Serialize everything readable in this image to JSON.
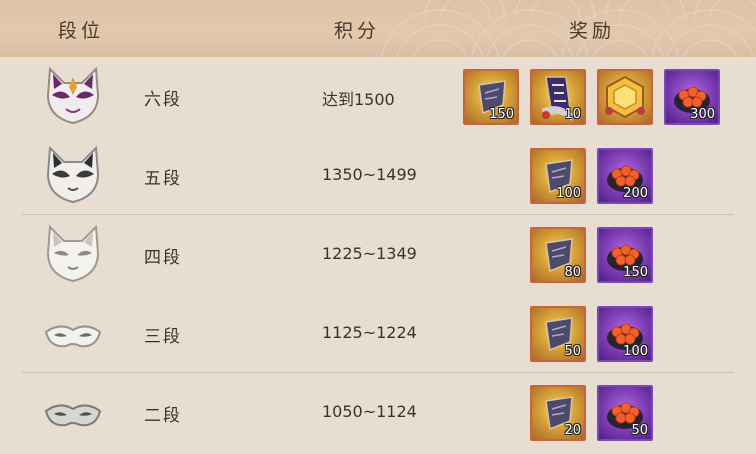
{
  "header": {
    "col_rank": "段位",
    "col_score": "积分",
    "col_reward": "奖励"
  },
  "rows": [
    {
      "tier": "六段",
      "mask_icon": "fox-mask-purple-icon",
      "score": "达到1500",
      "rewards": [
        {
          "icon": "scroll-ticket-icon",
          "qty": "150"
        },
        {
          "icon": "banner-card-icon",
          "qty": "10"
        },
        {
          "icon": "golden-frame-icon",
          "qty": ""
        },
        {
          "icon": "salmon-roe-sushi-icon",
          "qty": "300"
        }
      ]
    },
    {
      "tier": "五段",
      "mask_icon": "fox-mask-black-white-icon",
      "score": "1350~1499",
      "rewards": [
        {
          "icon": "scroll-ticket-icon",
          "qty": "100"
        },
        {
          "icon": "salmon-roe-sushi-icon",
          "qty": "200"
        }
      ]
    },
    {
      "tier": "四段",
      "mask_icon": "fox-mask-white-icon",
      "score": "1225~1349",
      "rewards": [
        {
          "icon": "scroll-ticket-icon",
          "qty": "80"
        },
        {
          "icon": "salmon-roe-sushi-icon",
          "qty": "150"
        }
      ]
    },
    {
      "tier": "三段",
      "mask_icon": "eye-mask-white-icon",
      "score": "1125~1224",
      "rewards": [
        {
          "icon": "scroll-ticket-icon",
          "qty": "50"
        },
        {
          "icon": "salmon-roe-sushi-icon",
          "qty": "100"
        }
      ]
    },
    {
      "tier": "二段",
      "mask_icon": "eye-mask-silver-icon",
      "score": "1050~1124",
      "rewards": [
        {
          "icon": "scroll-ticket-icon",
          "qty": "20"
        },
        {
          "icon": "salmon-roe-sushi-icon",
          "qty": "50"
        }
      ]
    }
  ],
  "colors": {
    "background": "#e7ddd0",
    "header": "#ddc2a6",
    "gold_frame": "#c8653e",
    "purple_frame": "#7a46b8",
    "text": "#3e3226"
  }
}
